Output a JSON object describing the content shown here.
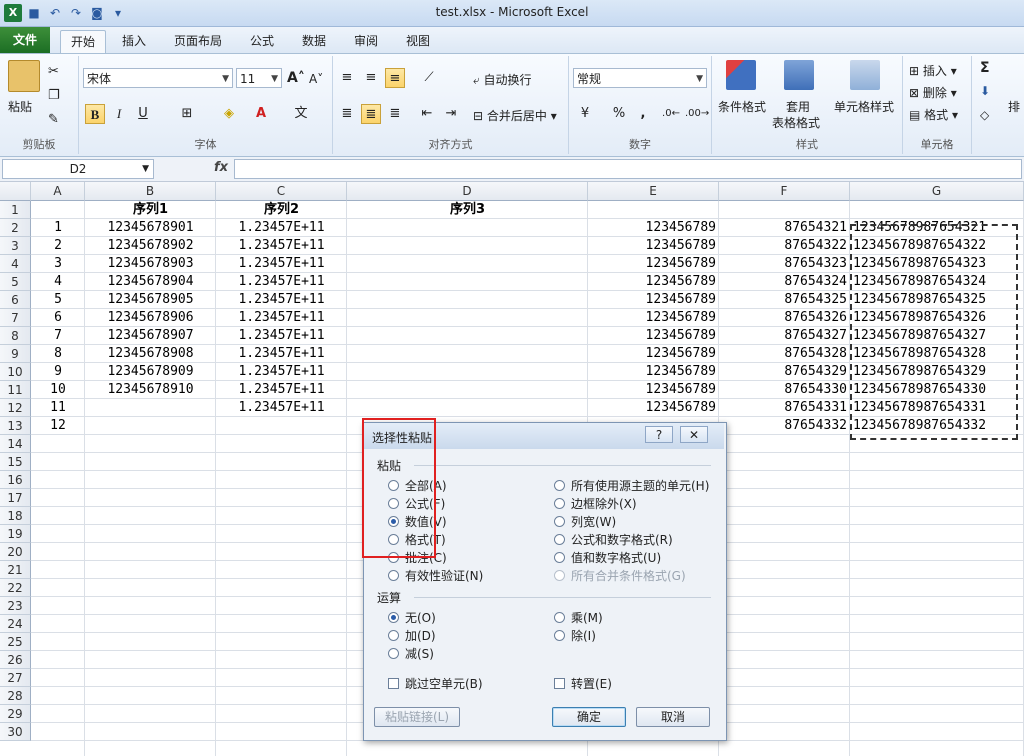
{
  "window": {
    "title": "test.xlsx  -  Microsoft Excel"
  },
  "tabs": [
    "文件",
    "开始",
    "插入",
    "页面布局",
    "公式",
    "数据",
    "审阅",
    "视图"
  ],
  "ribbon": {
    "clipboard": {
      "label": "剪贴板",
      "paste": "粘贴"
    },
    "font": {
      "label": "字体",
      "name": "宋体",
      "size": "11",
      "bold": "B",
      "italic": "I",
      "underline": "U"
    },
    "alignment": {
      "label": "对齐方式",
      "wrap": "自动换行",
      "merge": "合并后居中"
    },
    "number": {
      "label": "数字",
      "format": "常规",
      "percent": "%",
      "comma": ","
    },
    "styles": {
      "label": "样式",
      "conditional": "条件格式",
      "table_line1": "套用",
      "table_line2": "表格格式",
      "cell_style": "单元格样式"
    },
    "cells": {
      "label": "单元格",
      "insert": "插入",
      "delete": "删除",
      "format": "格式"
    },
    "editing": {
      "sigma": "Σ",
      "sort": "排"
    }
  },
  "formula_bar": {
    "name_box": "D2",
    "fx": "fx",
    "value": ""
  },
  "columns": [
    "A",
    "B",
    "C",
    "D",
    "E",
    "F",
    "G"
  ],
  "rows": [
    "1",
    "2",
    "3",
    "4",
    "5",
    "6",
    "7",
    "8",
    "9",
    "10",
    "11",
    "12",
    "13",
    "14",
    "15",
    "16",
    "17",
    "18",
    "19",
    "20",
    "21",
    "22",
    "23",
    "24",
    "25",
    "26",
    "27",
    "28",
    "29",
    "30"
  ],
  "headers": {
    "B": "序列1",
    "C": "序列2",
    "D": "序列3"
  },
  "cells": {
    "A": [
      "1",
      "2",
      "3",
      "4",
      "5",
      "6",
      "7",
      "8",
      "9",
      "10",
      "11",
      "12"
    ],
    "B": [
      "12345678901",
      "12345678902",
      "12345678903",
      "12345678904",
      "12345678905",
      "12345678906",
      "12345678907",
      "12345678908",
      "12345678909",
      "12345678910"
    ],
    "C": [
      "1.23457E+11",
      "1.23457E+11",
      "1.23457E+11",
      "1.23457E+11",
      "1.23457E+11",
      "1.23457E+11",
      "1.23457E+11",
      "1.23457E+11",
      "1.23457E+11",
      "1.23457E+11",
      "1.23457E+11"
    ],
    "E": [
      "123456789",
      "123456789",
      "123456789",
      "123456789",
      "123456789",
      "123456789",
      "123456789",
      "123456789",
      "123456789",
      "123456789",
      "123456789"
    ],
    "F": [
      "87654321",
      "87654322",
      "87654323",
      "87654324",
      "87654325",
      "87654326",
      "87654327",
      "87654328",
      "87654329",
      "87654330",
      "87654331",
      "87654332"
    ],
    "G": [
      "12345678987654321",
      "12345678987654322",
      "12345678987654323",
      "12345678987654324",
      "12345678987654325",
      "12345678987654326",
      "12345678987654327",
      "12345678987654328",
      "12345678987654329",
      "12345678987654330",
      "12345678987654331",
      "12345678987654332"
    ]
  },
  "dialog": {
    "title": "选择性粘贴",
    "help": "?",
    "close": "✕",
    "paste_section": "粘贴",
    "paste_left": [
      "全部(A)",
      "公式(F)",
      "数值(V)",
      "格式(T)",
      "批注(C)",
      "有效性验证(N)"
    ],
    "paste_right": [
      "所有使用源主题的单元(H)",
      "边框除外(X)",
      "列宽(W)",
      "公式和数字格式(R)",
      "值和数字格式(U)",
      "所有合并条件格式(G)"
    ],
    "paste_selected": "数值(V)",
    "operation_section": "运算",
    "op_left": [
      "无(O)",
      "加(D)",
      "减(S)"
    ],
    "op_right": [
      "乘(M)",
      "除(I)"
    ],
    "op_selected": "无(O)",
    "skip_blanks": "跳过空单元(B)",
    "transpose": "转置(E)",
    "paste_link": "粘贴链接(L)",
    "ok": "确定",
    "cancel": "取消"
  }
}
